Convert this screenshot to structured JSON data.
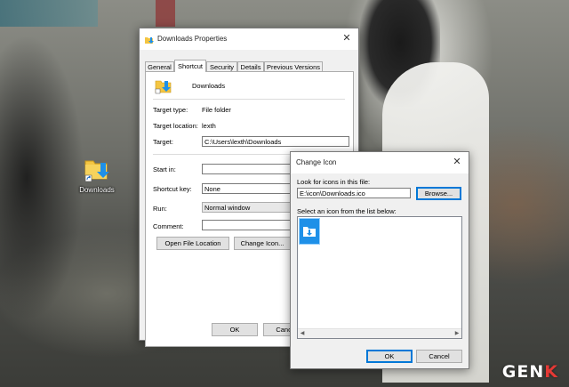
{
  "desktop": {
    "icon_label": "Downloads"
  },
  "properties_dialog": {
    "title": "Downloads Properties",
    "tabs": [
      {
        "label": "General"
      },
      {
        "label": "Shortcut"
      },
      {
        "label": "Security"
      },
      {
        "label": "Details"
      },
      {
        "label": "Previous Versions"
      }
    ],
    "active_tab": "Shortcut",
    "shortcut_name": "Downloads",
    "target_type_label": "Target type:",
    "target_type_value": "File folder",
    "target_location_label": "Target location:",
    "target_location_value": "lexth",
    "target_label": "Target:",
    "target_value": "C:\\Users\\lexth\\Downloads",
    "start_in_label": "Start in:",
    "start_in_value": "",
    "shortcut_key_label": "Shortcut key:",
    "shortcut_key_value": "None",
    "run_label": "Run:",
    "run_value": "Normal window",
    "comment_label": "Comment:",
    "comment_value": "",
    "open_file_location_button": "Open File Location",
    "change_icon_button": "Change Icon...",
    "ok_button": "OK",
    "cancel_button": "Cancel"
  },
  "change_icon_dialog": {
    "title": "Change Icon",
    "look_for_label": "Look for icons in this file:",
    "file_path_value": "E:\\icon\\Downloads.ico",
    "browse_button": "Browse...",
    "select_label": "Select an icon from the list below:",
    "ok_button": "OK",
    "cancel_button": "Cancel"
  },
  "watermark": {
    "text_main": "GEN",
    "text_accent": "K"
  },
  "colors": {
    "accent": "#0078d7",
    "selection": "#cce8ff",
    "icon_blue": "#1e90e8"
  }
}
